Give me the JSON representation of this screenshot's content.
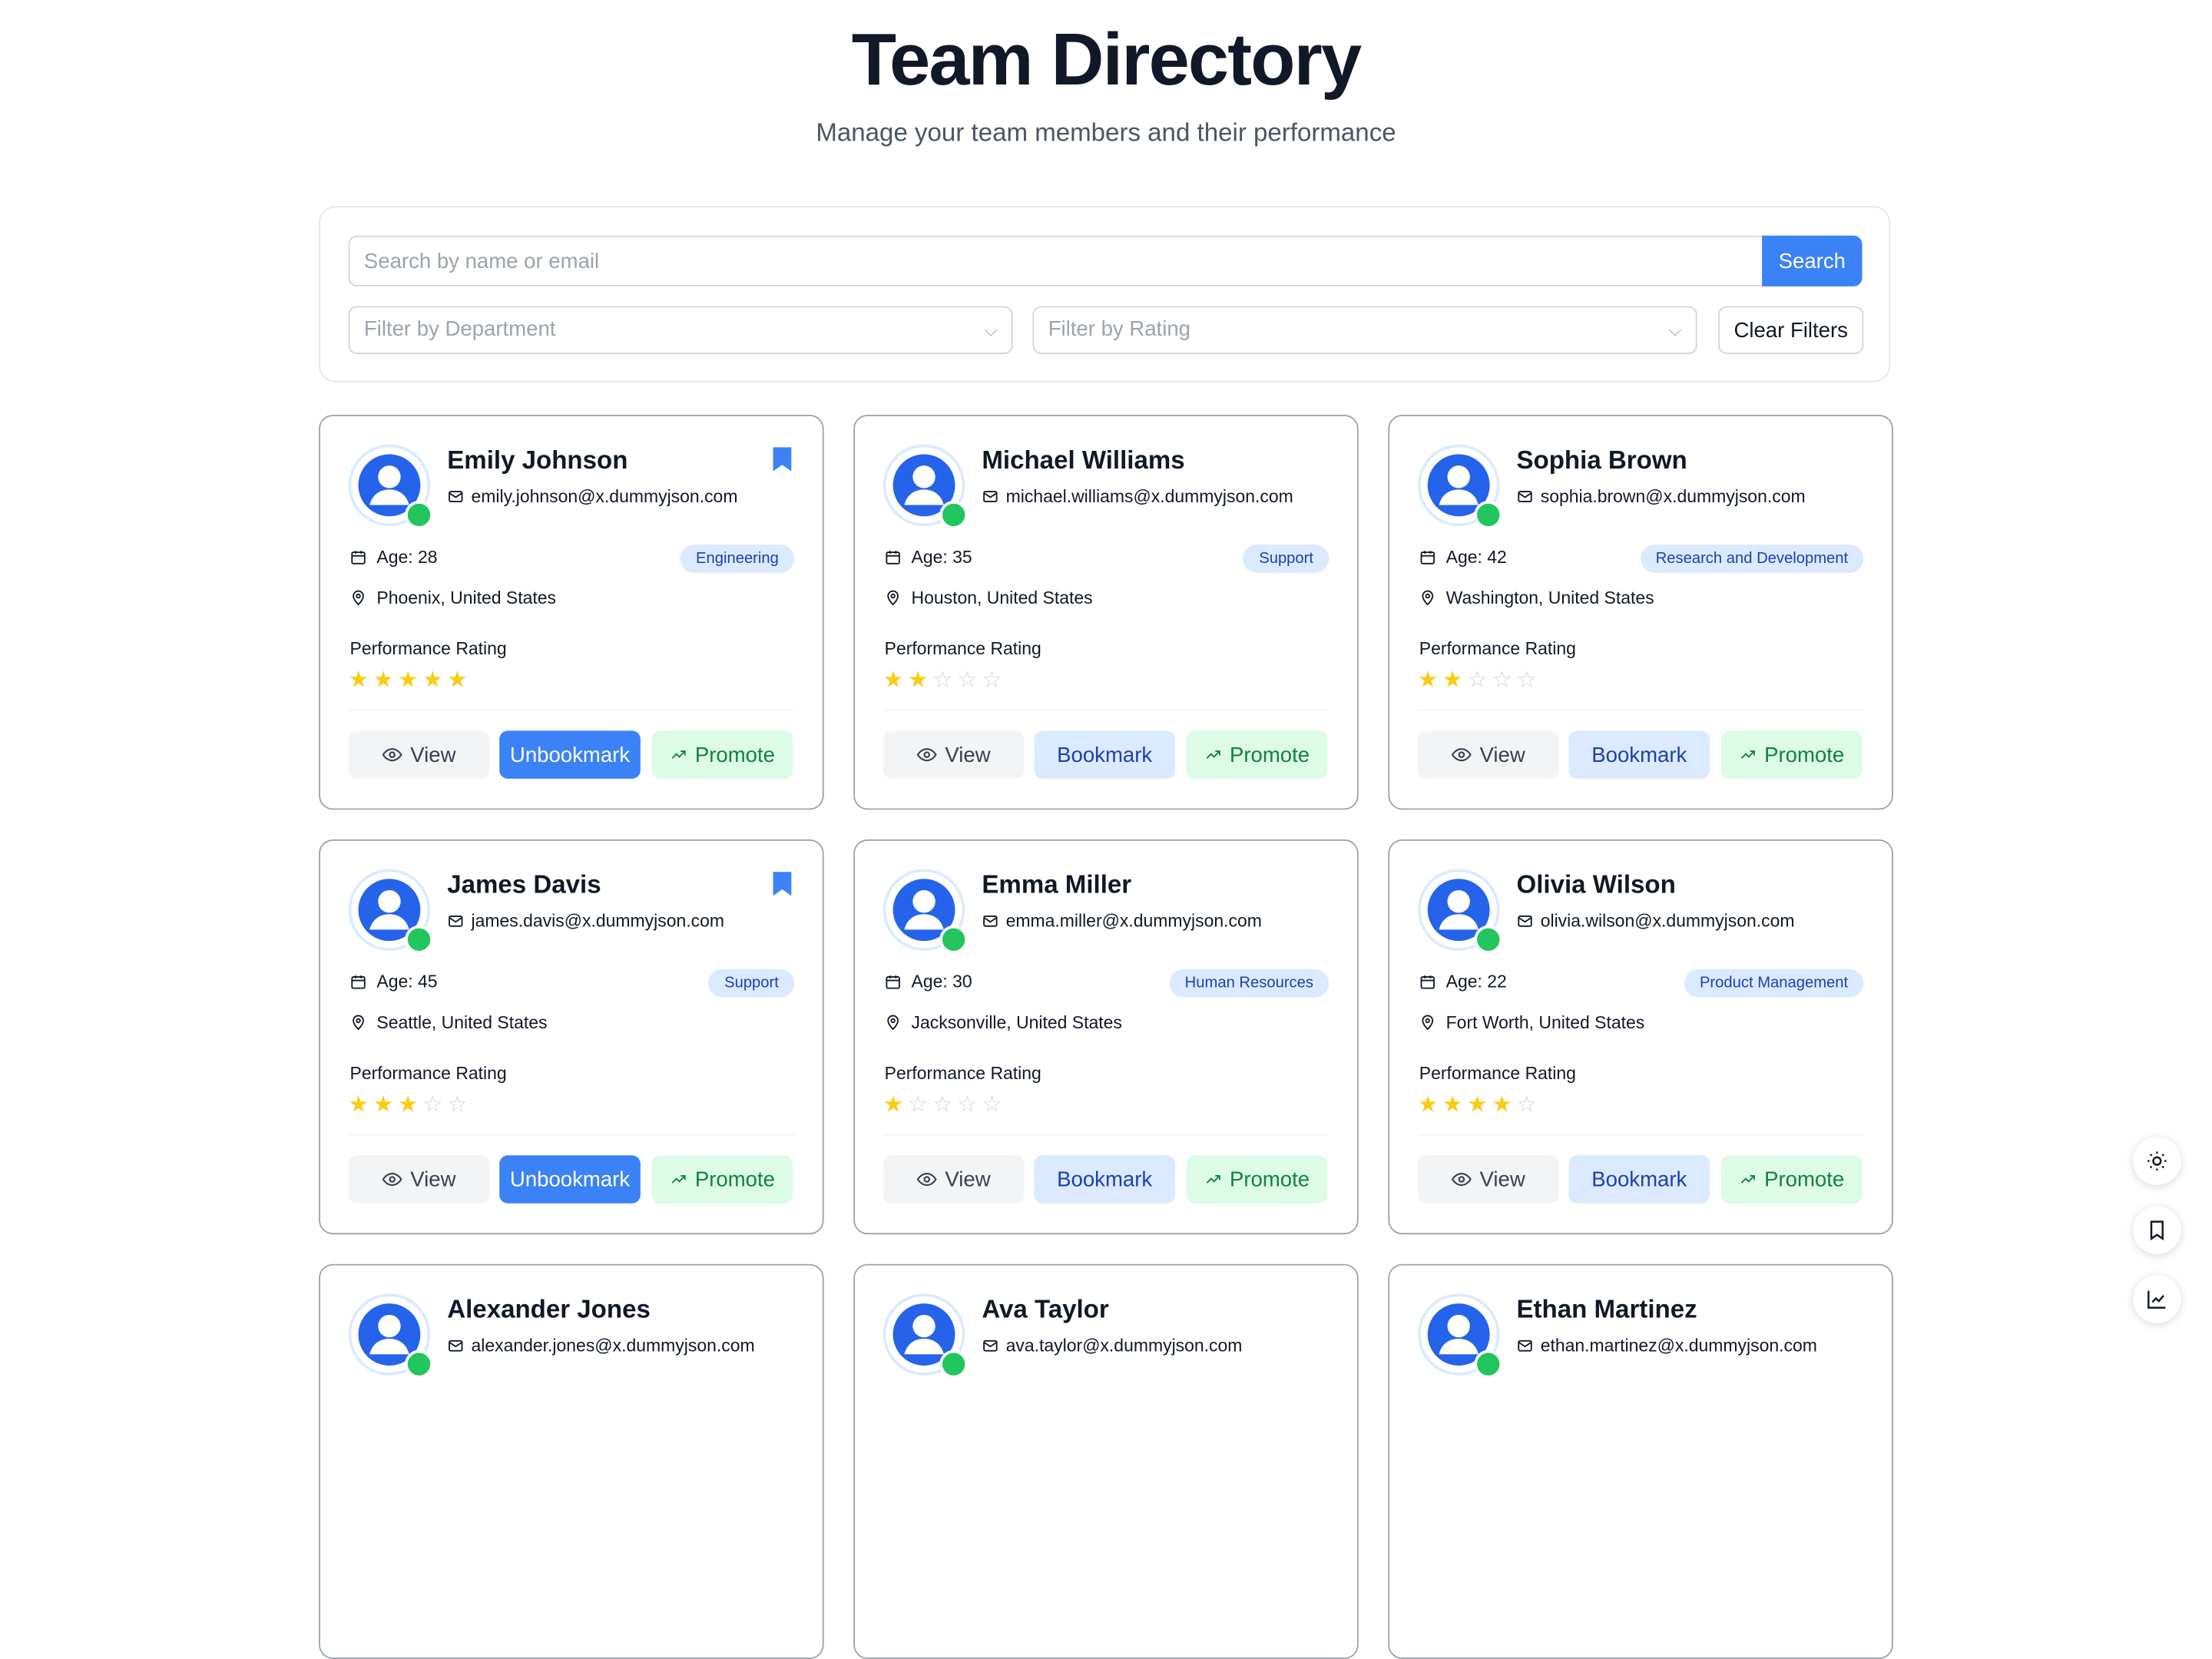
{
  "header": {
    "title": "Team Directory",
    "subtitle": "Manage your team members and their performance"
  },
  "filters": {
    "search_placeholder": "Search by name or email",
    "search_button": "Search",
    "department_placeholder": "Filter by Department",
    "rating_placeholder": "Filter by Rating",
    "clear_button": "Clear Filters"
  },
  "labels": {
    "performance": "Performance Rating",
    "view": "View",
    "bookmark": "Bookmark",
    "unbookmark": "Unbookmark",
    "promote": "Promote"
  },
  "members": [
    {
      "name": "Emily Johnson",
      "email": "emily.johnson@x.dummyjson.com",
      "age": "Age: 28",
      "department": "Engineering",
      "location": "Phoenix, United States",
      "rating": 5,
      "bookmarked": true
    },
    {
      "name": "Michael Williams",
      "email": "michael.williams@x.dummyjson.com",
      "age": "Age: 35",
      "department": "Support",
      "location": "Houston, United States",
      "rating": 2,
      "bookmarked": false
    },
    {
      "name": "Sophia Brown",
      "email": "sophia.brown@x.dummyjson.com",
      "age": "Age: 42",
      "department": "Research and Development",
      "location": "Washington, United States",
      "rating": 2,
      "bookmarked": false
    },
    {
      "name": "James Davis",
      "email": "james.davis@x.dummyjson.com",
      "age": "Age: 45",
      "department": "Support",
      "location": "Seattle, United States",
      "rating": 3,
      "bookmarked": true
    },
    {
      "name": "Emma Miller",
      "email": "emma.miller@x.dummyjson.com",
      "age": "Age: 30",
      "department": "Human Resources",
      "location": "Jacksonville, United States",
      "rating": 1,
      "bookmarked": false
    },
    {
      "name": "Olivia Wilson",
      "email": "olivia.wilson@x.dummyjson.com",
      "age": "Age: 22",
      "department": "Product Management",
      "location": "Fort Worth, United States",
      "rating": 4,
      "bookmarked": false
    },
    {
      "name": "Alexander Jones",
      "email": "alexander.jones@x.dummyjson.com",
      "bookmarked": false
    },
    {
      "name": "Ava Taylor",
      "email": "ava.taylor@x.dummyjson.com",
      "bookmarked": false
    },
    {
      "name": "Ethan Martinez",
      "email": "ethan.martinez@x.dummyjson.com",
      "bookmarked": false
    }
  ],
  "colors": {
    "primary": "#3b82f6",
    "online": "#22c55e",
    "star": "#facc15",
    "promote": "#15803d"
  },
  "floating_actions": [
    "sun-icon",
    "bookmark-icon",
    "chart-line-icon"
  ]
}
